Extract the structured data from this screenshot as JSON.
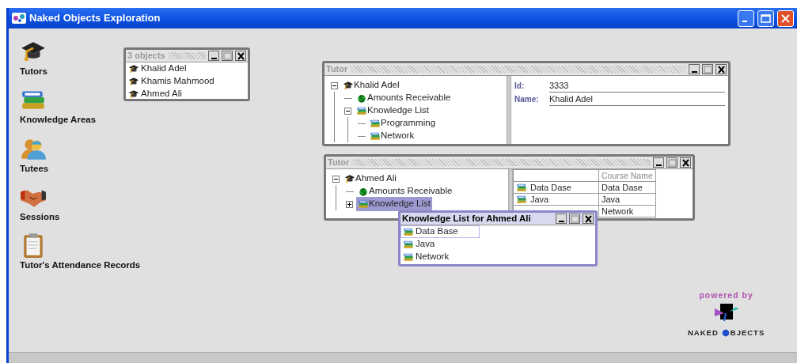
{
  "window": {
    "title": "Naked Objects Exploration"
  },
  "classes": [
    {
      "label": "Tutors",
      "kind": "tutor"
    },
    {
      "label": "Knowledge Areas",
      "kind": "books"
    },
    {
      "label": "Tutees",
      "kind": "people"
    },
    {
      "label": "Sessions",
      "kind": "handshake"
    },
    {
      "label": "Tutor's Attendance Records",
      "kind": "clipboard"
    }
  ],
  "windows": [
    {
      "kind": "list",
      "title": "3 objects",
      "active": false,
      "items": [
        {
          "label": "Khalid Adel",
          "kind": "tutor",
          "selected": false
        },
        {
          "label": "Khamis Mahmood",
          "kind": "tutor",
          "selected": false
        },
        {
          "label": "Ahmed Ali",
          "kind": "tutor",
          "selected": false
        }
      ]
    },
    {
      "kind": "tree_form",
      "title": "Tutor",
      "active": false,
      "tree": [
        {
          "label": "Khalid Adel",
          "kind": "tutor",
          "expanded": true,
          "selected": false,
          "children": [
            {
              "label": "Amounts Receivable",
              "kind": "money",
              "selected": false
            },
            {
              "label": "Knowledge List",
              "kind": "books",
              "expanded": true,
              "selected": false,
              "children": [
                {
                  "label": "Programming",
                  "kind": "books",
                  "selected": false
                },
                {
                  "label": "Network",
                  "kind": "books",
                  "selected": false
                }
              ]
            }
          ]
        }
      ],
      "fields": [
        {
          "label": "Id:",
          "value": "3333"
        },
        {
          "label": "Name:",
          "value": "Khalid Adel"
        }
      ]
    },
    {
      "kind": "tree_table",
      "title": "Tutor",
      "active": false,
      "tree": [
        {
          "label": "Ahmed Ali",
          "kind": "tutor",
          "expanded": true,
          "selected": false,
          "children": [
            {
              "label": "Amounts Receivable",
              "kind": "money",
              "selected": false
            },
            {
              "label": "Knowledge List",
              "kind": "books",
              "expanded": false,
              "selected": true
            }
          ]
        }
      ],
      "table": {
        "columns": [
          "Course Name"
        ],
        "rows": [
          {
            "name": "Data Dase",
            "course_name": "Data Dase"
          },
          {
            "name": "Java",
            "course_name": "Java"
          },
          {
            "course_name": "Network"
          }
        ]
      }
    },
    {
      "kind": "list",
      "title": "Knowledge List for Ahmed Ali",
      "active": true,
      "items": [
        {
          "label": "Data Base",
          "kind": "books",
          "selected": true
        },
        {
          "label": "Java",
          "kind": "books",
          "selected": false
        },
        {
          "label": "Network",
          "kind": "books",
          "selected": false
        }
      ]
    }
  ],
  "logo": {
    "caption": "powered by",
    "brand_left": "NAKED",
    "brand_right": "BJECTS"
  }
}
